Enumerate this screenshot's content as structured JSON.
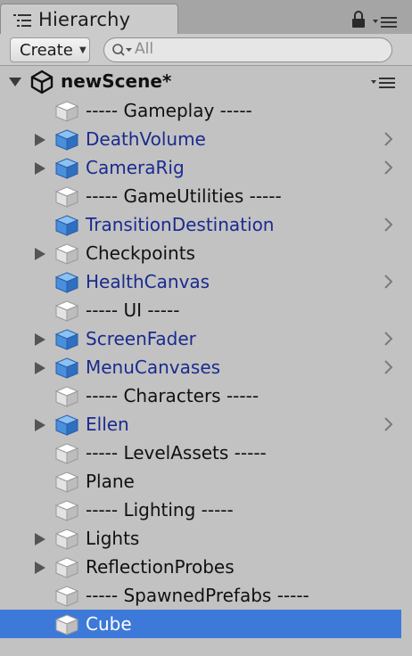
{
  "window": {
    "tab_title": "Hierarchy",
    "icons": [
      "hierarchy-list-icon",
      "lock-icon",
      "panel-menu-icon"
    ]
  },
  "toolbar": {
    "create_label": "Create",
    "search_placeholder": "All"
  },
  "scene": {
    "name": "newScene*"
  },
  "colors": {
    "selection": "#3d79d8",
    "prefab_text": "#1a2b8f",
    "panel_bg": "#c2c2c2",
    "cube_prefab": "#4a90d9",
    "cube_plain": "#e6e6e6"
  },
  "items": [
    {
      "label": "----- Gameplay -----",
      "prefab": false,
      "expandable": false,
      "selected": false
    },
    {
      "label": "DeathVolume",
      "prefab": true,
      "expandable": true,
      "selected": false
    },
    {
      "label": "CameraRig",
      "prefab": true,
      "expandable": true,
      "selected": false
    },
    {
      "label": "----- GameUtilities -----",
      "prefab": false,
      "expandable": false,
      "selected": false
    },
    {
      "label": "TransitionDestination",
      "prefab": true,
      "expandable": false,
      "selected": false
    },
    {
      "label": "Checkpoints",
      "prefab": false,
      "expandable": true,
      "selected": false
    },
    {
      "label": "HealthCanvas",
      "prefab": true,
      "expandable": false,
      "selected": false
    },
    {
      "label": "----- UI -----",
      "prefab": false,
      "expandable": false,
      "selected": false
    },
    {
      "label": "ScreenFader",
      "prefab": true,
      "expandable": true,
      "selected": false
    },
    {
      "label": "MenuCanvases",
      "prefab": true,
      "expandable": true,
      "selected": false
    },
    {
      "label": "----- Characters -----",
      "prefab": false,
      "expandable": false,
      "selected": false
    },
    {
      "label": "Ellen",
      "prefab": true,
      "expandable": true,
      "selected": false
    },
    {
      "label": "----- LevelAssets -----",
      "prefab": false,
      "expandable": false,
      "selected": false
    },
    {
      "label": "Plane",
      "prefab": false,
      "expandable": false,
      "selected": false
    },
    {
      "label": "----- Lighting -----",
      "prefab": false,
      "expandable": false,
      "selected": false
    },
    {
      "label": "Lights",
      "prefab": false,
      "expandable": true,
      "selected": false
    },
    {
      "label": "ReflectionProbes",
      "prefab": false,
      "expandable": true,
      "selected": false
    },
    {
      "label": "----- SpawnedPrefabs -----",
      "prefab": false,
      "expandable": false,
      "selected": false
    },
    {
      "label": "Cube",
      "prefab": false,
      "expandable": false,
      "selected": true
    }
  ]
}
